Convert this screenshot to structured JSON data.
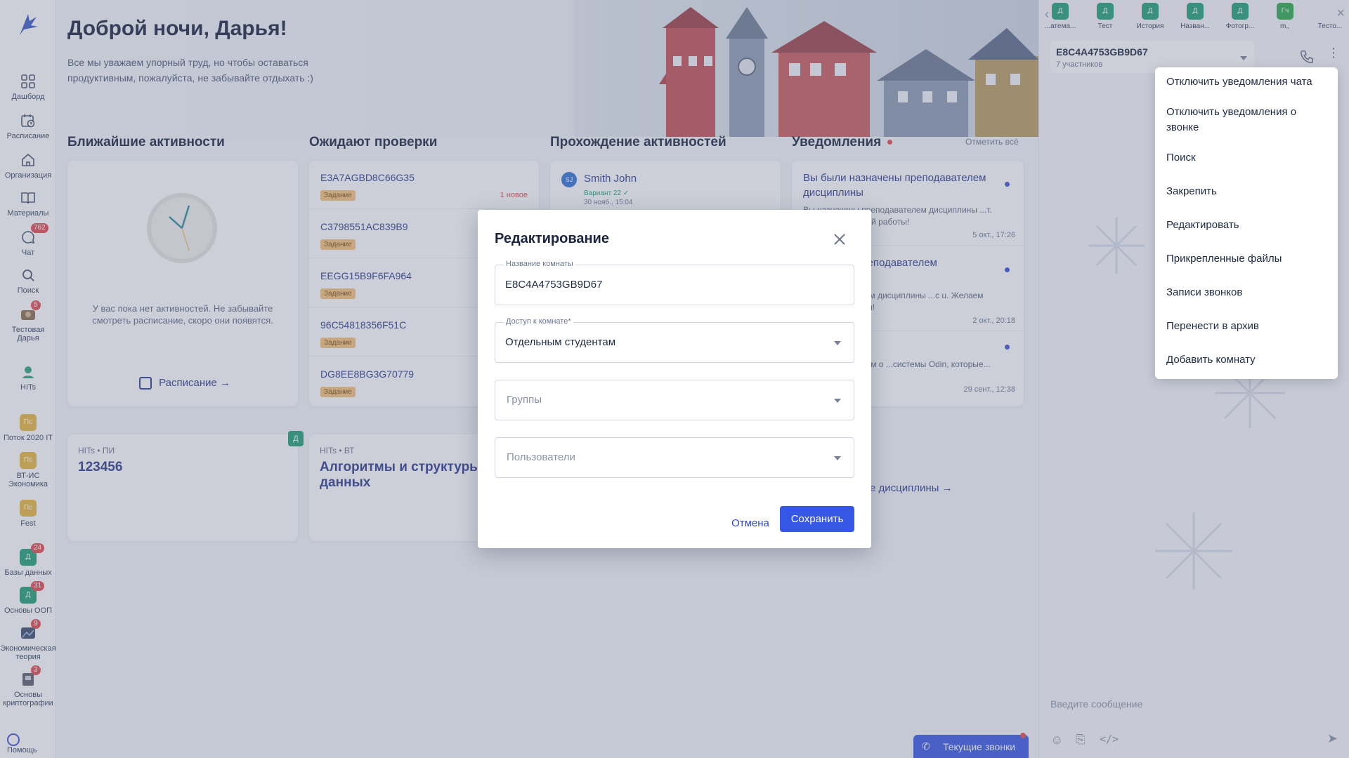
{
  "sidebar": {
    "items": [
      {
        "label": "Дашборд",
        "icon": "grid-icon"
      },
      {
        "label": "Расписание",
        "icon": "calendar-clock-icon"
      },
      {
        "label": "Организация",
        "icon": "home-icon"
      },
      {
        "label": "Материалы",
        "icon": "book-icon"
      },
      {
        "label": "Чат",
        "icon": "chat-icon",
        "badge": "762"
      },
      {
        "label": "Поиск",
        "icon": "search-icon"
      },
      {
        "label": "Тестовая Дарья",
        "icon": "avatar-icon",
        "badge": "5"
      },
      {
        "label": "HITs",
        "icon": "avatar-icon"
      },
      {
        "label": "Поток 2020 IT",
        "initials": "Пс",
        "color": "#e9b53c"
      },
      {
        "label": "ВТ-ИС Экономика",
        "initials": "Пс",
        "color": "#e9b53c"
      },
      {
        "label": "Fest",
        "initials": "Пс",
        "color": "#e9b53c"
      },
      {
        "label": "Базы данных",
        "initials": "Д",
        "color": "#1e9e74",
        "badge": "24"
      },
      {
        "label": "Основы ООП",
        "initials": "Д",
        "color": "#1e9e74",
        "badge": "31"
      },
      {
        "label": "Экономическая теория",
        "icon": "avatar-icon",
        "badge": "9"
      },
      {
        "label": "Основы криптографии",
        "icon": "avatar-icon",
        "badge": "3"
      }
    ],
    "help": "Помощь"
  },
  "header": {
    "greeting": "Доброй ночи, Дарья!",
    "subtitle": "Все мы уважаем упорный труд, но чтобы оставаться продуктивным, пожалуйста, не забывайте отдыхать :)"
  },
  "columns": {
    "upcoming": {
      "title": "Ближайшие активности",
      "empty_text": "У вас пока нет активностей. Не забывайте смотреть расписание, скоро они появятся.",
      "link": "Расписание"
    },
    "review": {
      "title": "Ожидают проверки",
      "items": [
        {
          "name": "E3A7AGBD8C66G35",
          "tag": "Задание",
          "new": "1 новое"
        },
        {
          "name": "C3798551AC839B9",
          "tag": "Задание"
        },
        {
          "name": "EEGG15B9F6FA964",
          "tag": "Задание"
        },
        {
          "name": "96C54818356F51C",
          "tag": "Задание"
        },
        {
          "name": "DG8EE8BG3G70779",
          "tag": "Задание"
        }
      ]
    },
    "progress": {
      "title": "Прохождение активностей",
      "item": {
        "initials": "SJ",
        "name": "Smith John",
        "variant": "Вариант 22 ✓",
        "time": "30 нояб., 15:04"
      }
    },
    "notifications": {
      "title": "Уведомления",
      "mark_all": "Отметить всё",
      "items": [
        {
          "title": "Вы были назначены преподавателем дисциплины",
          "text": "Вы назначены преподавателем дисциплины ...т. Желаем успешной работы!",
          "time": "5 окт., 17:26"
        },
        {
          "title": "...значены преподавателем",
          "text": "...преподавателем дисциплины ...с u. Желаем успешной работы!",
          "time": "2 окт., 20:18"
        },
        {
          "title": "",
          "text": "...годня расскажем о ...системы Odin, которые...",
          "time": "29 сент., 12:38"
        }
      ],
      "all_link": "...се дисциплины →"
    }
  },
  "disciplines": [
    {
      "meta": "HITs • ПИ",
      "title": "123456",
      "badge": "Д"
    },
    {
      "meta": "HITs • ВТ",
      "title": "Алгоритмы и структуры данных"
    }
  ],
  "chat": {
    "tabs": [
      {
        "label": "...атема...",
        "initials": "Д"
      },
      {
        "label": "Тест",
        "initials": "Д"
      },
      {
        "label": "История",
        "initials": "Д"
      },
      {
        "label": "Назван...",
        "initials": "Д"
      },
      {
        "label": "Фотогр...",
        "initials": "Д"
      },
      {
        "label": "m,,",
        "initials": "Гч"
      },
      {
        "label": "Тесто...",
        "initials": ""
      }
    ],
    "room_name": "E8C4A4753GB9D67",
    "participants": "7 участников",
    "input_placeholder": "Введите сообщение",
    "calls_button": "Текущие звонки"
  },
  "menu": {
    "items": [
      "Отключить уведомления чата",
      "Отключить уведомления о звонке",
      "Поиск",
      "Закрепить",
      "Редактировать",
      "Прикрепленные файлы",
      "Записи звонков",
      "Перенести в архив",
      "Добавить комнату"
    ]
  },
  "modal": {
    "title": "Редактирование",
    "room_name_label": "Название комнаты",
    "room_name_value": "E8C4A4753GB9D67",
    "access_label": "Доступ к комнате*",
    "access_value": "Отдельным студентам",
    "groups_placeholder": "Группы",
    "users_placeholder": "Пользователи",
    "cancel": "Отмена",
    "save": "Сохранить"
  },
  "colors": {
    "accent": "#3656e6",
    "badge": "#e5484d",
    "green": "#1e9e74",
    "tag": "#f6c27a"
  }
}
